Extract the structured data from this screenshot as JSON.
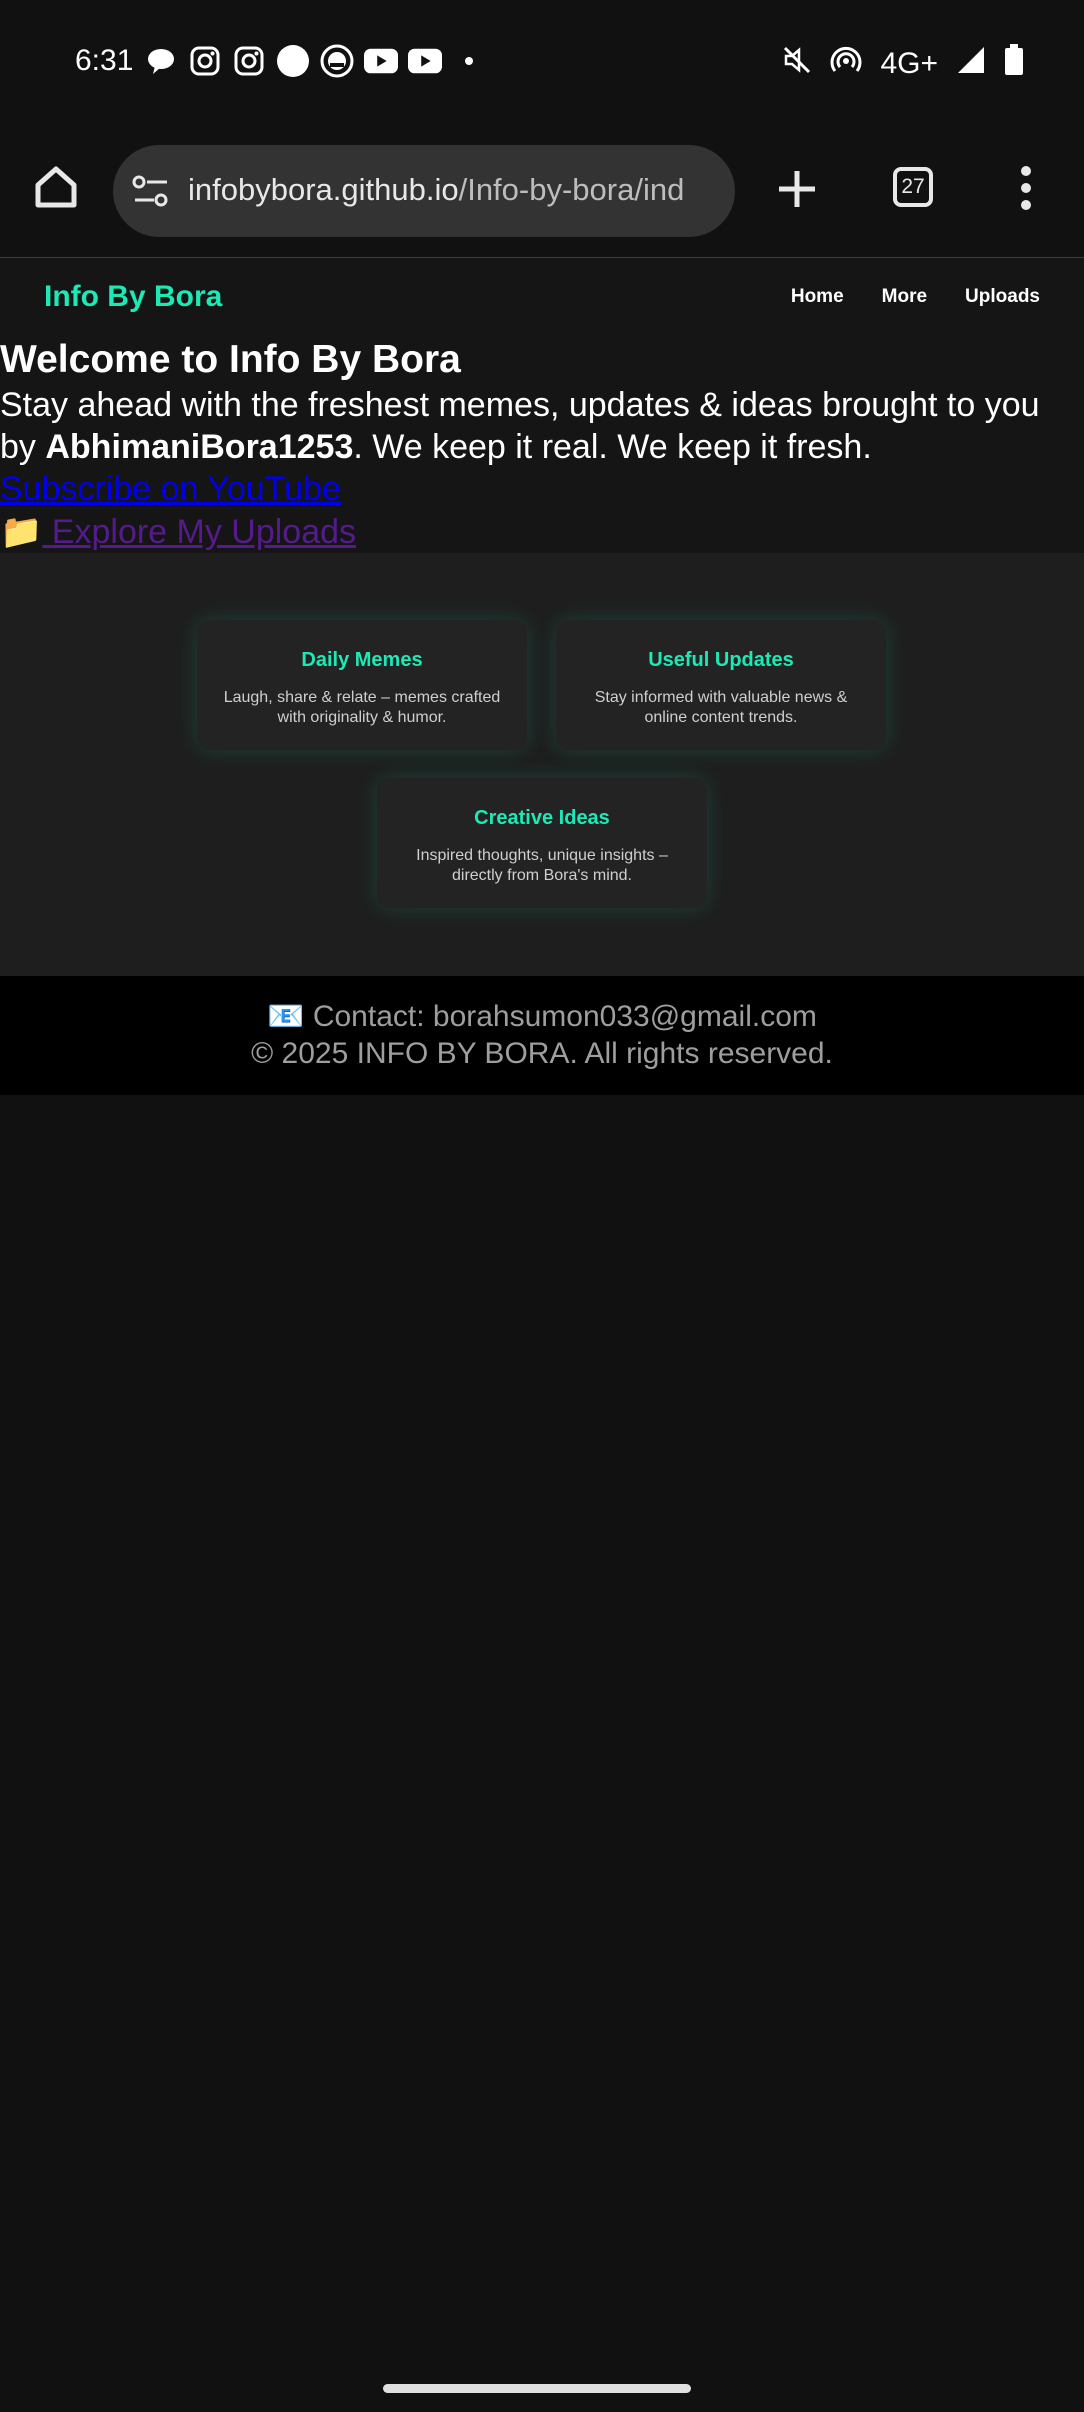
{
  "status_bar": {
    "time": "6:31",
    "notification_icons": [
      "chat-bubble-icon",
      "instagram-icon",
      "instagram-icon",
      "circle-icon",
      "badge-icon",
      "youtube-icon",
      "youtube-icon",
      "dot-icon"
    ],
    "network": "4G+",
    "status_icons": [
      "mute-icon",
      "hotspot-icon",
      "signal-icon",
      "battery-icon"
    ]
  },
  "browser": {
    "url_host": "infobybora.github.io",
    "url_path": "/Info-by-bora/ind",
    "tab_count": "27"
  },
  "site": {
    "brand": "Info By Bora",
    "nav": [
      "Home",
      "More",
      "Uploads"
    ],
    "hero": {
      "title": "Welcome to Info By Bora",
      "intro_before": "Stay ahead with the freshest memes, updates & ideas brought to you by ",
      "intro_author": "AbhimaniBora1253",
      "intro_after": ". We keep it real. We keep it fresh.",
      "youtube_link": "Subscribe on YouTube",
      "uploads_link_icon": "📁",
      "uploads_link": "Explore My Uploads"
    },
    "features": [
      {
        "title": "Daily Memes",
        "desc": "Laugh, share & relate – memes crafted with originality & humor."
      },
      {
        "title": "Useful Updates",
        "desc": "Stay informed with valuable news & online content trends."
      },
      {
        "title": "Creative Ideas",
        "desc": "Inspired thoughts, unique insights – directly from Bora's mind."
      }
    ],
    "footer": {
      "contact_icon": "📧",
      "contact": "Contact: borahsumon033@gmail.com",
      "copyright": "© 2025 INFO BY BORA. All rights reserved."
    }
  },
  "colors": {
    "accent": "#1de9b6",
    "background": "#111111",
    "link": "#0000ee",
    "visited_link": "#551a8b"
  }
}
